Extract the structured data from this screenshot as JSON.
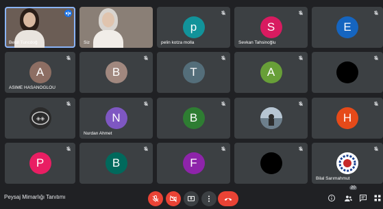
{
  "meeting": {
    "title": "Peysaj Mimarlığı Tanıtımı",
    "participant_count": "20"
  },
  "colors": {
    "background": "#202124",
    "tile": "#3c4043",
    "leave_red": "#ea4335",
    "speaking_blue": "#8ab4f8"
  },
  "tiles": [
    {
      "name": "Betül Tuncdoğ",
      "kind": "camera",
      "speaking": true
    },
    {
      "name": "Siz",
      "kind": "camera"
    },
    {
      "name": "pelin kotza molla",
      "initial": "p",
      "avatar_color": "#12939a",
      "muted": true
    },
    {
      "name": "Sevkan Tahsinoğlu",
      "initial": "S",
      "avatar_color": "#d81b60",
      "muted": true
    },
    {
      "name": "",
      "initial": "E",
      "avatar_color": "#1565c0",
      "muted": true
    },
    {
      "name": "ASIME HASANOGLOU",
      "initial": "A",
      "avatar_color": "#8d6e63",
      "muted": true
    },
    {
      "name": "",
      "initial": "B",
      "avatar_color": "#a1887f",
      "muted": true
    },
    {
      "name": "",
      "initial": "T",
      "avatar_color": "#546e7a",
      "muted": true
    },
    {
      "name": "",
      "initial": "A",
      "avatar_color": "#689f38",
      "muted": true
    },
    {
      "name": "",
      "initial": "",
      "avatar_color": "#000000",
      "muted": true
    },
    {
      "name": "",
      "initial": "",
      "avatar_color": "#2b2b2b",
      "muted": true,
      "logo": true
    },
    {
      "name": "Nurdan Ahmet",
      "initial": "N",
      "avatar_color": "#7e57c2",
      "muted": true
    },
    {
      "name": "",
      "initial": "B",
      "avatar_color": "#2e7d32",
      "muted": true
    },
    {
      "name": "",
      "initial": "",
      "avatar_color": "#8fa3b5",
      "muted": true,
      "photo": true
    },
    {
      "name": "",
      "initial": "H",
      "avatar_color": "#e64a19",
      "muted": true
    },
    {
      "name": "",
      "initial": "P",
      "avatar_color": "#e91e63",
      "muted": true
    },
    {
      "name": "",
      "initial": "B",
      "avatar_color": "#00695c",
      "muted": true
    },
    {
      "name": "",
      "initial": "F",
      "avatar_color": "#8e24aa",
      "muted": true
    },
    {
      "name": "",
      "initial": "",
      "avatar_color": "#000000",
      "muted": true
    },
    {
      "name": "Bilal Sarımahmut",
      "initial": "",
      "avatar_color": "#ffffff",
      "muted": true,
      "emblem": true
    }
  ],
  "controls": [
    {
      "name": "mic-toggle-button",
      "icon": "mic-off-icon"
    },
    {
      "name": "camera-toggle-button",
      "icon": "camera-off-icon"
    },
    {
      "name": "present-screen-button",
      "icon": "present-icon"
    },
    {
      "name": "more-options-button",
      "icon": "more-vert-icon"
    },
    {
      "name": "leave-call-button",
      "icon": "phone-hangup-icon"
    }
  ],
  "right_icons": [
    "info-icon",
    "people-icon",
    "chat-icon",
    "activities-icon"
  ]
}
